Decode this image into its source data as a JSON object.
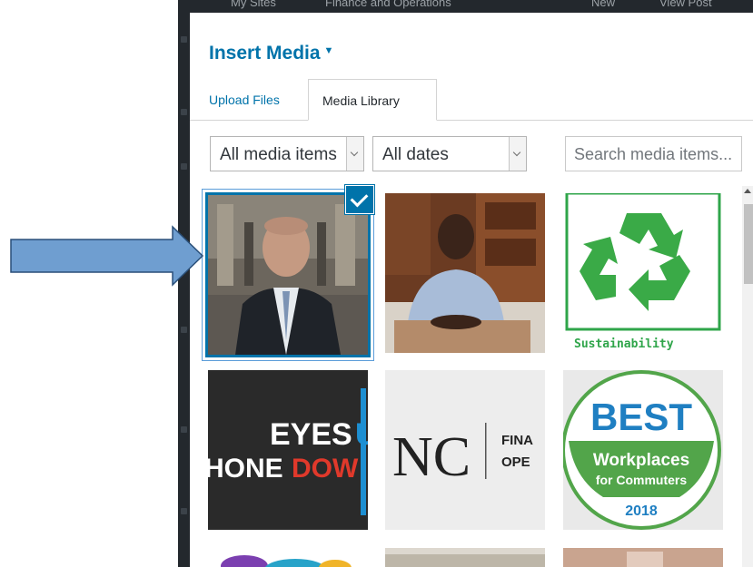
{
  "topbar": {
    "my_sites": "My Sites",
    "site_name": "Finance and Operations",
    "new_label": "New",
    "view_post": "View Post"
  },
  "modal": {
    "title": "Insert Media"
  },
  "tabs": [
    {
      "label": "Upload Files",
      "active": false
    },
    {
      "label": "Media Library",
      "active": true
    }
  ],
  "filters": {
    "type_selected": "All media items",
    "date_selected": "All dates",
    "search_placeholder": "Search media items..."
  },
  "media": {
    "sustainability_caption": "Sustainability",
    "eyes_line1": "EYES",
    "eyes_line1_cut": "U",
    "eyes_line2": "HONE",
    "eyes_line2_cut": "DOW",
    "nc_logo": "NC",
    "nc_side_line1": "FINA",
    "nc_side_line2": "OPE",
    "best_title": "BEST",
    "best_line1": "Workplaces",
    "best_line2": "for Commuters",
    "best_year": "2018"
  },
  "colors": {
    "accent": "#0073aa",
    "admin_bar": "#23282d",
    "recycle_green": "#3aaa47",
    "arrow_fill": "#6f9ed0",
    "arrow_stroke": "#2a4f78"
  },
  "icons": {
    "selected_check": "checkmark-icon",
    "select_caret": "chevron-down-icon",
    "title_caret": "caret-down-icon"
  }
}
